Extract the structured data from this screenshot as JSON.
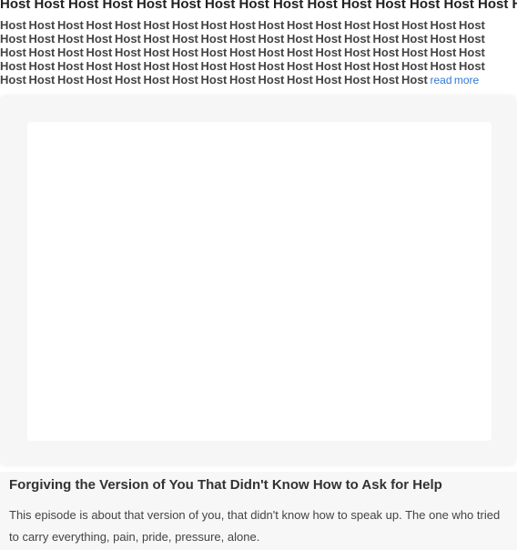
{
  "header": {
    "title_line": "Host Host Host Host Host Host Host Host Host Host Host Host Host Host Host Host Host Host"
  },
  "description": {
    "filler_text": "Host Host Host Host Host Host Host Host Host Host Host Host Host Host Host Host Host Host Host Host Host Host Host Host Host Host Host Host Host Host Host Host Host Host Host Host Host Host Host Host Host Host Host Host Host Host Host Host Host Host Host Host Host Host Host Host Host Host Host Host Host Host Host Host Host Host Host Host Host Host Host Host Host Host Host Host Host Host Host Host Host Host Host",
    "read_more_label": "read more"
  },
  "episode": {
    "title": "Forgiving the Version of You That Didn't Know How to Ask for Help",
    "description": "This episode is about that version of you, that didn't know how to speak up. The one who tried to carry everything, pain, pride, pressure, alone."
  }
}
